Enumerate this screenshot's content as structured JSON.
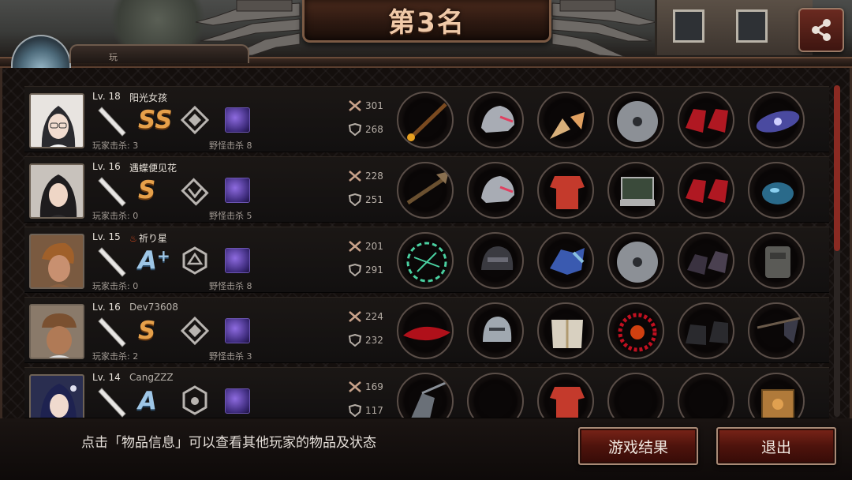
{
  "header": {
    "title": "第3名",
    "sub_label": "玩"
  },
  "players": [
    {
      "level": "Lv. 18",
      "name": "阳光女孩",
      "grade": "SS",
      "player_kills": "玩家击杀: 3",
      "monster_kills": "野怪击杀 8",
      "attack": "301",
      "defense": "268"
    },
    {
      "level": "Lv. 16",
      "name": "遇蝶便见花",
      "grade": "S",
      "player_kills": "玩家击杀: 0",
      "monster_kills": "野怪击杀 5",
      "attack": "228",
      "defense": "251"
    },
    {
      "level": "Lv. 15",
      "name": "祈り星",
      "grade": "A",
      "grade_plus": "+",
      "player_kills": "玩家击杀: 0",
      "monster_kills": "野怪击杀 8",
      "attack": "201",
      "defense": "291"
    },
    {
      "level": "Lv. 16",
      "name": "Dev73608",
      "grade": "S",
      "player_kills": "玩家击杀: 2",
      "monster_kills": "野怪击杀 3",
      "attack": "224",
      "defense": "232"
    },
    {
      "level": "Lv. 14",
      "name": "CangZZZ",
      "grade": "A",
      "attack": "169",
      "defense": "117"
    }
  ],
  "footer": {
    "hint": "点击「物品信息」可以查看其他玩家的物品及状态",
    "result_button": "游戏结果",
    "exit_button": "退出"
  },
  "colors": {
    "accent_red": "#7a2418",
    "gold_grade": "#e6a04a",
    "blue_grade": "#9ec6e6"
  },
  "icons": [
    "share-icon",
    "sword-icon",
    "shield-icon",
    "bat-icon",
    "emblem-icon",
    "monster-card-icon"
  ]
}
